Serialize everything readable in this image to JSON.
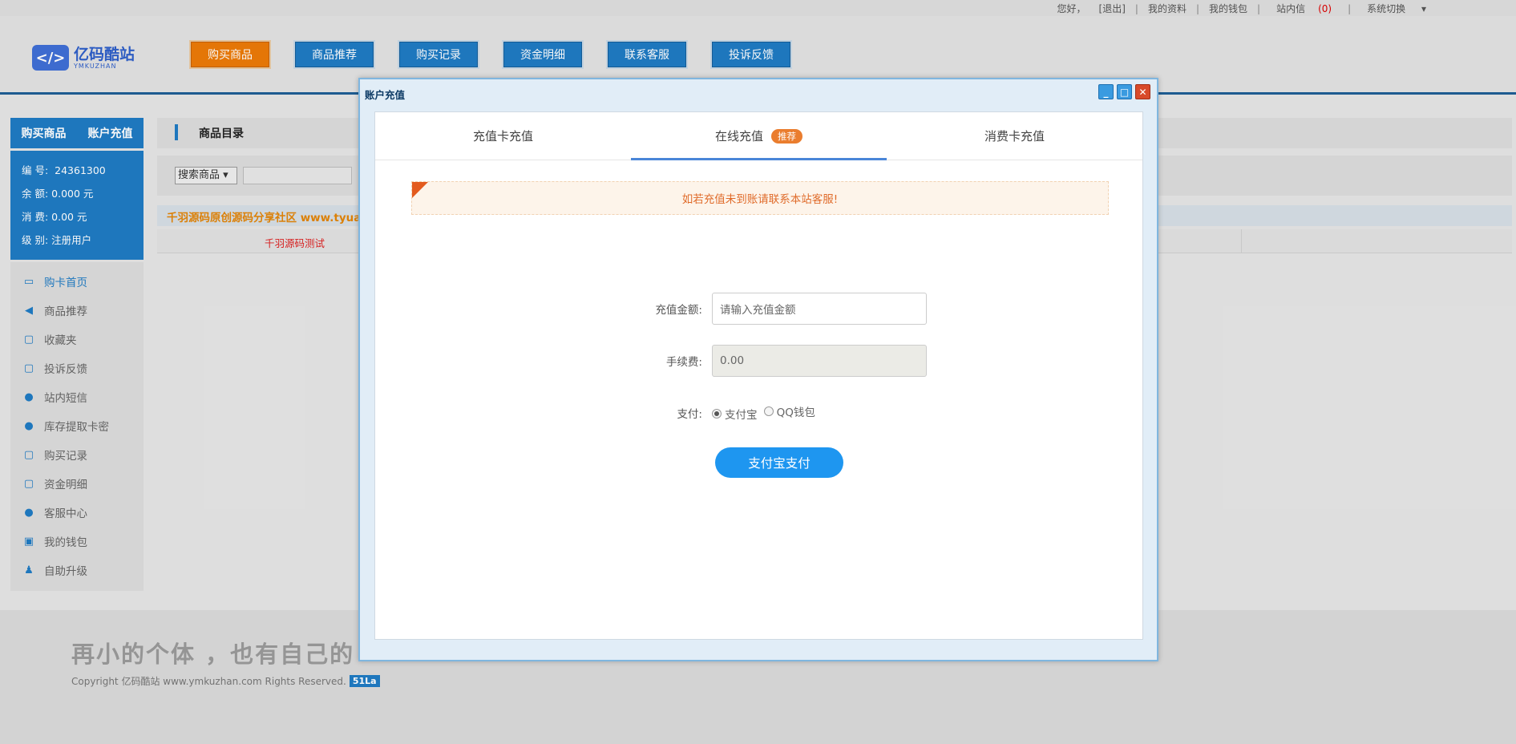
{
  "topbar": {
    "greeting": "您好，",
    "logout": "[退出]",
    "my_profile": "我的资料",
    "my_wallet": "我的钱包",
    "messages": "站内信",
    "message_count": "(0)",
    "switch": "系统切换",
    "separator": "|"
  },
  "logo": {
    "mark": "</>",
    "name_cn": "亿码酷站",
    "name_en": "YMKUZHAN"
  },
  "nav": [
    {
      "label": "购买商品",
      "active": true
    },
    {
      "label": "商品推荐"
    },
    {
      "label": "购买记录"
    },
    {
      "label": "资金明细"
    },
    {
      "label": "联系客服"
    },
    {
      "label": "投诉反馈"
    }
  ],
  "sidebar": {
    "tab_buy": "购买商品",
    "tab_recharge": "账户充值",
    "info": [
      {
        "label": "编 号:",
        "value": "24361300"
      },
      {
        "label": "余 额:",
        "value": "0.000 元"
      },
      {
        "label": "消 费:",
        "value": "0.00 元"
      },
      {
        "label": "级 别:",
        "value": "注册用户"
      }
    ],
    "menu": [
      {
        "label": "购卡首页",
        "icon": "home-card-icon"
      },
      {
        "label": "商品推荐",
        "icon": "megaphone-icon"
      },
      {
        "label": "收藏夹",
        "icon": "chat-icon"
      },
      {
        "label": "投诉反馈",
        "icon": "chat-icon"
      },
      {
        "label": "站内短信",
        "icon": "bubbles-icon"
      },
      {
        "label": "库存提取卡密",
        "icon": "bubbles-icon"
      },
      {
        "label": "购买记录",
        "icon": "chat-icon"
      },
      {
        "label": "资金明细",
        "icon": "chat-icon"
      },
      {
        "label": "客服中心",
        "icon": "bubbles-icon"
      },
      {
        "label": "我的钱包",
        "icon": "wallet-icon"
      },
      {
        "label": "自助升级",
        "icon": "user-icon"
      }
    ]
  },
  "main": {
    "title": "商品目录",
    "search_select": "搜索商品",
    "notice": "千羽源码原创源码分享社区 www.tyuan",
    "product_name": "千羽源码测试"
  },
  "footer": {
    "slogan": "再小的个体 ，也有自己的",
    "copyright": "Copyright 亿码酷站 www.ymkuzhan.com Rights Reserved.",
    "badge": "51La"
  },
  "modal": {
    "title": "账户充值",
    "tabs": [
      {
        "label": "充值卡充值"
      },
      {
        "label": "在线充值",
        "badge": "推荐",
        "active": true
      },
      {
        "label": "消费卡充值"
      }
    ],
    "warning": "如若充值未到账请联系本站客服!",
    "amount_label": "充值金额:",
    "amount_placeholder": "请输入充值金额",
    "fee_label": "手续费:",
    "fee_value": "0.00",
    "pay_label": "支付:",
    "pay_options": [
      {
        "label": "支付宝",
        "selected": true
      },
      {
        "label": "QQ钱包",
        "selected": false
      }
    ],
    "submit_label": "支付宝支付"
  },
  "colors": {
    "primary": "#1f7bc4",
    "accent": "#ec7a08",
    "pay_button": "#1e96f0",
    "warning_text": "#e06b2a"
  }
}
